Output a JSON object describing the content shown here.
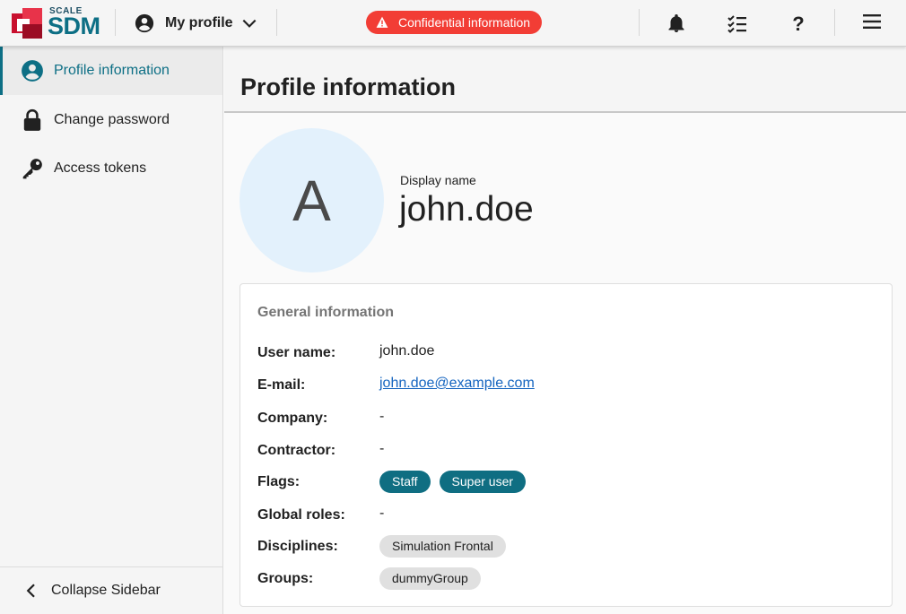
{
  "brand": {
    "small": "SCALE",
    "big": "SDM",
    "colors": {
      "primary": "#0d6f85",
      "logo_red": "#c8102e"
    }
  },
  "topbar": {
    "profile_menu_label": "My profile",
    "confidential_label": "Confidential information",
    "icons": [
      "account-circle-icon",
      "chevron-down-icon",
      "warning-icon",
      "bell-icon",
      "checklist-icon",
      "help-icon",
      "menu-icon"
    ],
    "help_glyph": "?"
  },
  "sidebar": {
    "items": [
      {
        "label": "Profile information",
        "icon": "account-circle-icon",
        "active": true
      },
      {
        "label": "Change password",
        "icon": "lock-icon",
        "active": false
      },
      {
        "label": "Access tokens",
        "icon": "key-icon",
        "active": false
      }
    ],
    "collapse_label": "Collapse Sidebar"
  },
  "main": {
    "title": "Profile information",
    "avatar_letter": "A",
    "display_name_label": "Display name",
    "display_name": "john.doe",
    "general": {
      "title": "General information",
      "user_name_label": "User name:",
      "user_name": "john.doe",
      "email_label": "E-mail:",
      "email": "john.doe@example.com",
      "company_label": "Company:",
      "company": "-",
      "contractor_label": "Contractor:",
      "contractor": "-",
      "flags_label": "Flags:",
      "flags": [
        "Staff",
        "Super user"
      ],
      "global_roles_label": "Global roles:",
      "global_roles": "-",
      "disciplines_label": "Disciplines:",
      "disciplines": [
        "Simulation Frontal"
      ],
      "groups_label": "Groups:",
      "groups": [
        "dummyGroup"
      ]
    }
  }
}
